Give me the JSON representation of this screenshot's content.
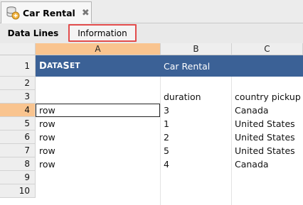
{
  "editor_tab": {
    "title": "Car Rental",
    "icon": "database-icon",
    "close": "✖"
  },
  "subtabs": {
    "data_lines": "Data Lines",
    "information": "Information"
  },
  "grid": {
    "columns": [
      "A",
      "B",
      "C"
    ],
    "rows": [
      "1",
      "2",
      "3",
      "4",
      "5",
      "6",
      "7",
      "8",
      "9",
      "10"
    ],
    "dataset_title_first": "D",
    "dataset_title_rest": "ATA ",
    "dataset_title_first2": "S",
    "dataset_title_rest2": "ET",
    "dataset_name": "Car Rental",
    "headers": {
      "b": "duration",
      "c": "country pickup"
    },
    "records": [
      {
        "a": "row",
        "b": "3",
        "c": "Canada"
      },
      {
        "a": "row",
        "b": "1",
        "c": "United States"
      },
      {
        "a": "row",
        "b": "2",
        "c": "United States"
      },
      {
        "a": "row",
        "b": "5",
        "c": "United States"
      },
      {
        "a": "row",
        "b": "4",
        "c": "Canada"
      }
    ],
    "selected_row": "4",
    "selected_column": "A"
  },
  "colors": {
    "dataset_band": "#3b6196",
    "selection_header": "#f9c48f",
    "tab_highlight": "#e24c4c"
  }
}
